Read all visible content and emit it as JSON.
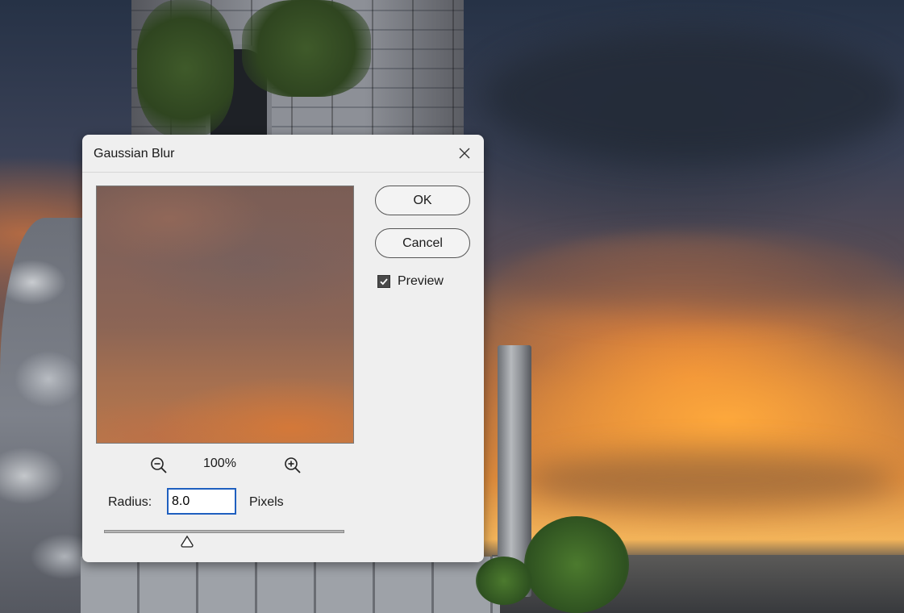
{
  "dialog": {
    "title": "Gaussian Blur",
    "ok_label": "OK",
    "cancel_label": "Cancel",
    "preview_label": "Preview",
    "preview_checked": true,
    "zoom_level": "100%",
    "radius_label": "Radius:",
    "radius_value": "8.0",
    "units_label": "Pixels",
    "radius_slider_fraction": 0.35
  },
  "icons": {
    "close": "close-icon",
    "zoom_out": "zoom-out-icon",
    "zoom_in": "zoom-in-icon",
    "check": "checkmark-icon",
    "slider_thumb": "triangle-thumb-icon"
  },
  "colors": {
    "dialog_bg": "#efefef",
    "input_focus_border": "#1f5fbf"
  }
}
